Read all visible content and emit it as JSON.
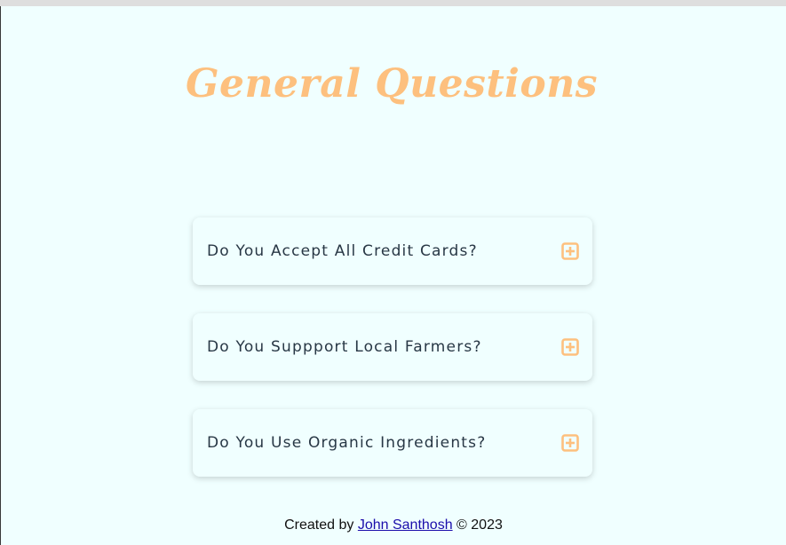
{
  "page": {
    "title": "General Questions"
  },
  "faqs": [
    {
      "question": "Do You Accept All Credit Cards?",
      "icon": "plus-square-icon"
    },
    {
      "question": "Do You Suppport Local Farmers?",
      "icon": "plus-square-icon"
    },
    {
      "question": "Do You Use Organic Ingredients?",
      "icon": "plus-square-icon"
    }
  ],
  "footer": {
    "prefix": "Created by ",
    "author": "John Santhosh",
    "suffix": " © 2023"
  },
  "colors": {
    "background": "#f0ffff",
    "accent": "#fdc07e",
    "question_text": "#283745"
  }
}
